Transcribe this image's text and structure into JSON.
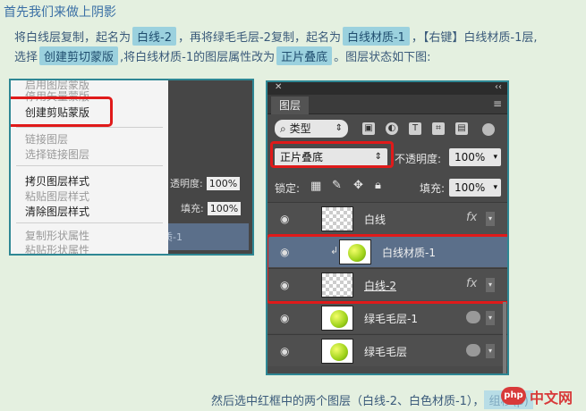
{
  "article": {
    "heading": "首先我们来做上阴影",
    "line1": {
      "p1": "将白线层复制，起名为",
      "t1": "白线-2",
      "p2": "，再将绿毛毛层-2复制，起名为",
      "t2": "白线材质-1",
      "p3": "，【右键】白线材质-1层,"
    },
    "line2": {
      "p1": "选择",
      "t1": "创建剪切蒙版",
      "p2": ",将白线材质-1的图层属性改为",
      "t2": "正片叠底",
      "p3": "。图层状态如下图:"
    },
    "line3": {
      "text": "然后选中红框中的两个图层（白线-2、白色材质-1），",
      "tag": "组移(p)"
    }
  },
  "context_menu": {
    "items": [
      {
        "label": "启用图层蒙版",
        "enabled": false
      },
      {
        "label": "停用矢量蒙版",
        "enabled": false
      },
      {
        "label": "创建剪贴蒙版",
        "enabled": true,
        "highlighted": true
      },
      {
        "label": "链接图层",
        "enabled": false
      },
      {
        "label": "选择链接图层",
        "enabled": false
      },
      {
        "label": "拷贝图层样式",
        "enabled": true
      },
      {
        "label": "粘贴图层样式",
        "enabled": false
      },
      {
        "label": "清除图层样式",
        "enabled": true
      },
      {
        "label": "复制形状属性",
        "enabled": false
      },
      {
        "label": "粘贴形状属性",
        "enabled": false
      }
    ],
    "bg_panel": {
      "opacity_label": "透明度:",
      "opacity_value": "100%",
      "fill_label": "填充:",
      "fill_value": "100%",
      "layer_name": "复材质-1"
    }
  },
  "layers_panel": {
    "tab": "图层",
    "filter": "类型",
    "blend_mode": "正片叠底",
    "opacity_label": "不透明度:",
    "opacity_value": "100%",
    "lock_label": "锁定:",
    "fill_label": "填充:",
    "fill_value": "100%",
    "layers": [
      {
        "name": "白线",
        "thumb": "transparent",
        "fx": true,
        "selected": false
      },
      {
        "name": "白线材质-1",
        "thumb": "ball",
        "clipped": true,
        "selected": true
      },
      {
        "name": "白线-2",
        "thumb": "transparent",
        "fx": true,
        "selected": false
      },
      {
        "name": "绿毛毛层-1",
        "thumb": "ball",
        "mask": true,
        "selected": false
      },
      {
        "name": "绿毛毛层",
        "thumb": "ball",
        "mask": true,
        "selected": false
      }
    ]
  },
  "watermark": {
    "logo": "php",
    "text_cn": "中文网"
  },
  "colors": {
    "highlight": "#e01a1a",
    "tag_bg": "#9bd1de",
    "selection": "#5b6f8a",
    "frame": "#2e8794"
  }
}
